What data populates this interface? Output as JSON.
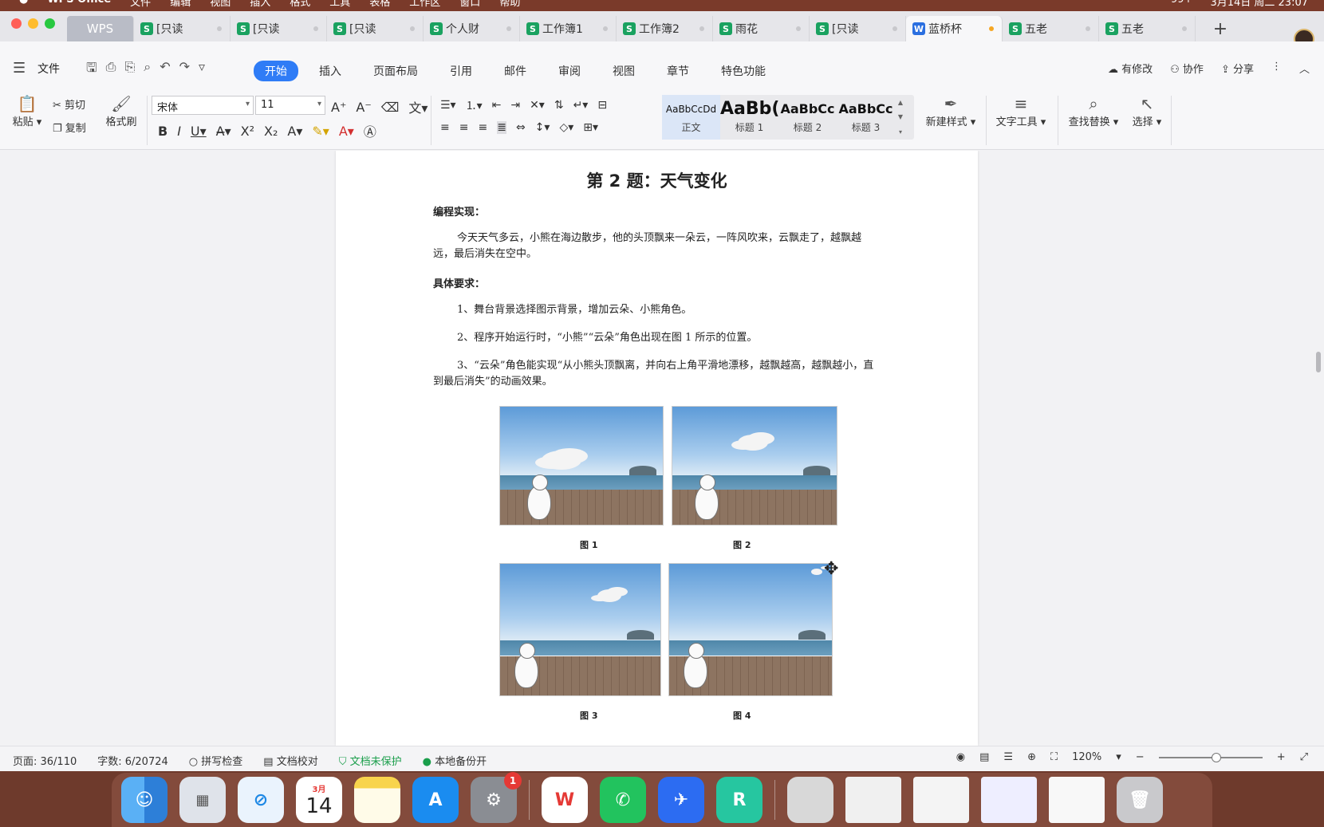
{
  "menubar": {
    "app_name": "WPS Office",
    "menus": [
      "文件",
      "编辑",
      "视图",
      "插入",
      "格式",
      "工具",
      "表格",
      "工作区",
      "窗口",
      "帮助"
    ],
    "clock": "3月14日 周二 23:07",
    "badge": "99+"
  },
  "tabs": [
    {
      "label": "WPS",
      "kind": "home"
    },
    {
      "label": "[只读",
      "kind": "s"
    },
    {
      "label": "[只读",
      "kind": "s"
    },
    {
      "label": "[只读",
      "kind": "s"
    },
    {
      "label": "个人财",
      "kind": "s"
    },
    {
      "label": "工作簿1",
      "kind": "s"
    },
    {
      "label": "工作簿2",
      "kind": "s"
    },
    {
      "label": "雨花",
      "kind": "s"
    },
    {
      "label": "[只读",
      "kind": "s"
    },
    {
      "label": "蓝桥杯",
      "kind": "w",
      "active": true
    },
    {
      "label": "五老",
      "kind": "s"
    },
    {
      "label": "五老",
      "kind": "s"
    }
  ],
  "menurow": {
    "file": "文件",
    "ribbon_tabs": [
      "开始",
      "插入",
      "页面布局",
      "引用",
      "邮件",
      "审阅",
      "视图",
      "章节",
      "特色功能"
    ],
    "right": {
      "modified": "有修改",
      "collab": "协作",
      "share": "分享"
    }
  },
  "ribbon": {
    "paste": "粘贴",
    "cut": "剪切",
    "copy": "复制",
    "format_painter": "格式刷",
    "font_name": "宋体",
    "font_size": "11",
    "styles": [
      {
        "preview": "AaBbCcDd",
        "name": "正文"
      },
      {
        "preview": "AaBb(",
        "name": "标题 1"
      },
      {
        "preview": "AaBbCc",
        "name": "标题 2"
      },
      {
        "preview": "AaBbCc",
        "name": "标题 3"
      }
    ],
    "new_style": "新建样式",
    "text_tools": "文字工具",
    "find_replace": "查找替换",
    "select": "选择"
  },
  "doc": {
    "title": "第 2 题：天气变化",
    "h_impl": "编程实现：",
    "para1": "今天天气多云，小熊在海边散步，他的头顶飘来一朵云，一阵风吹来，云飘走了，越飘越远，最后消失在空中。",
    "h_req": "具体要求：",
    "req1": "1、舞台背景选择图示背景，增加云朵、小熊角色。",
    "req2": "2、程序开始运行时，“小熊”“云朵”角色出现在图 1 所示的位置。",
    "req3": "3、“云朵”角色能实现“从小熊头顶飘离，并向右上角平滑地漂移，越飘越高，越飘越小，直到最后消失”的动画效果。",
    "fig1": "图 1",
    "fig2": "图 2",
    "fig3": "图 3",
    "fig4": "图 4"
  },
  "status": {
    "page": "页面: 36/110",
    "words": "字数: 6/20724",
    "spell": "拼写检查",
    "proof": "文档校对",
    "protect": "文档未保护",
    "backup": "本地备份开",
    "zoom": "120%"
  },
  "dock": {
    "calendar_month": "3月",
    "calendar_day": "14",
    "settings_badge": "1"
  }
}
